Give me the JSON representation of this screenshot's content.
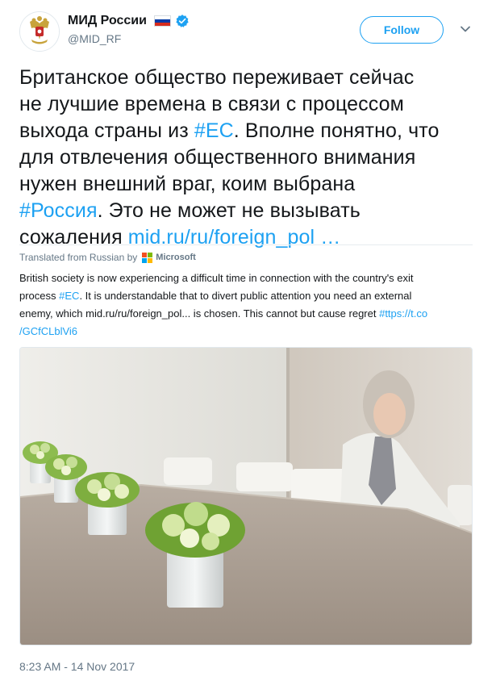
{
  "header": {
    "display_name": "МИД России",
    "handle": "@MID_RF",
    "follow_label": "Follow",
    "flag_colors": [
      "#ffffff",
      "#0039a6",
      "#d52b1e"
    ],
    "verified_color": "#1da1f2"
  },
  "tweet": {
    "line1": "Британское общество переживает сейчас",
    "line2": "не лучшие времена в связи с процессом",
    "line3_pre": "выхода страны из ",
    "line3_hash": "#ЕС",
    "line3_post": ". Вполне понятно, что",
    "line4": "для отвлечения общественного внимания",
    "line5": "нужен внешний враг, коим выбрана",
    "line6_hash": "#Россия",
    "line6_post": ". Это не может не вызывать",
    "line7_pre": "сожаления ",
    "line7_link": "mid.ru/ru/foreign_pol",
    "line7_ellipsis": " …"
  },
  "translation": {
    "label": "Translated from Russian by",
    "provider": "Microsoft",
    "line1": "British society is now experiencing a difficult time in connection with the country's exit",
    "line2_pre": "process ",
    "line2_hash": "#EC",
    "line2_post": ". It is understandable that to divert public attention you need an external",
    "line3_pre": "enemy, which mid.ru/ru/foreign_pol... is chosen. This cannot but cause regret ",
    "line3_link": "#ttps://t.co",
    "line4_link": "/GCfCLblVi6"
  },
  "timestamp": "8:23 AM - 14 Nov 2017",
  "colors": {
    "accent": "#1da1f2",
    "text": "#14171a",
    "muted": "#657786"
  },
  "icons": {
    "avatar": "coat-of-arms-icon",
    "verified": "verified-badge-icon",
    "menu": "chevron-down-icon",
    "provider": "microsoft-logo-icon"
  }
}
